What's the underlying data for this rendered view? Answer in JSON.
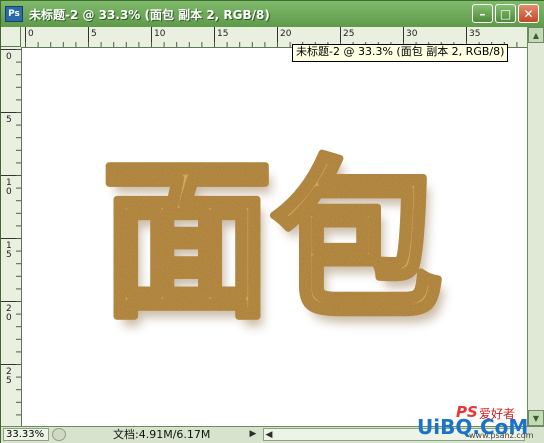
{
  "window": {
    "title": "未标题-2 @ 33.3% (面包 副本 2, RGB/8)",
    "app_icon_label": "Ps",
    "minimize_label": "–",
    "maximize_label": "□",
    "close_label": "✕"
  },
  "ruler": {
    "top_labels": [
      "0",
      "5",
      "10",
      "15",
      "20",
      "25",
      "30",
      "35"
    ],
    "left_labels": [
      "0",
      "5",
      "10",
      "15",
      "20",
      "25"
    ]
  },
  "tooltip": {
    "text": "未标题-2 @ 33.3% (面包 副本 2, RGB/8)"
  },
  "canvas": {
    "text": "面包",
    "text_color": "#d9a85a",
    "text_edge_color": "#a9782e"
  },
  "status": {
    "zoom": "33.33%",
    "doc_info": "文档:4.91M/6.17M",
    "arrow_right": "▶",
    "arrow_left": "◀"
  },
  "watermark": {
    "ps_text": "PS",
    "site_cn": "爱好者",
    "site_domain": "UiBQ.CoM",
    "url": "www.psahz.com"
  },
  "colors": {
    "title_bar": "#5f9a4b",
    "window_frame": "#8bb67a",
    "accent_red": "#d02020"
  }
}
